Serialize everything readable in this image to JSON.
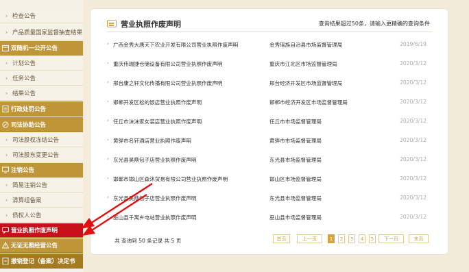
{
  "sidebar": {
    "items": [
      {
        "label": "检查公告",
        "kind": "sub"
      },
      {
        "label": "产品质量国家监督抽查结果",
        "kind": "sub"
      },
      {
        "label": "双随机一公开公告",
        "kind": "head",
        "icon": "calendar-icon"
      },
      {
        "label": "计划公告",
        "kind": "sub"
      },
      {
        "label": "任务公告",
        "kind": "sub"
      },
      {
        "label": "结果公告",
        "kind": "sub"
      },
      {
        "label": "行政处罚公告",
        "kind": "head",
        "icon": "document-icon"
      },
      {
        "label": "司法协助公告",
        "kind": "head",
        "icon": "gavel-icon"
      },
      {
        "label": "司法股权冻结公告",
        "kind": "sub"
      },
      {
        "label": "司法股东变更公告",
        "kind": "sub"
      },
      {
        "label": "注销公告",
        "kind": "head",
        "icon": "monitor-icon"
      },
      {
        "label": "简易注销公告",
        "kind": "sub"
      },
      {
        "label": "清算组备案",
        "kind": "sub"
      },
      {
        "label": "债权人公告",
        "kind": "sub"
      },
      {
        "label": "营业执照作废声明",
        "kind": "active",
        "icon": "chat-icon"
      },
      {
        "label": "无证无照经营公告",
        "kind": "head",
        "icon": "warning-icon"
      },
      {
        "label": "撤销登记（备案）决定书",
        "kind": "dark",
        "icon": "doc-icon"
      }
    ]
  },
  "panel": {
    "title": "营业执照作废声明",
    "note": "查询结果超过50条，请输入更精确的查询条件",
    "rows": [
      {
        "name": "广西金秀大唐天下农业开发有限公司营业执照作废声明",
        "org": "金秀瑶族自治县市场监督管理局",
        "date": "2019/6/19"
      },
      {
        "name": "重庆伟瑞捷仓储设备有限公司营业执照作废声明",
        "org": "重庆市江北区市场监督管理局",
        "date": "2020/3/12"
      },
      {
        "name": "邢台康之轩文化传播有限公司营业执照作废声明",
        "org": "邢台经济开发区市场监督管理局",
        "date": "2020/3/12"
      },
      {
        "name": "邯郸开发区松的饭店营业执照作废声明",
        "org": "邯郸市经济开发区市场监督管理局",
        "date": "2020/3/12"
      },
      {
        "name": "任丘市沫沫家女装店营业执照作废声明",
        "org": "任丘市市场监督管理局",
        "date": "2020/3/12"
      },
      {
        "name": "黄骅市名轩酒店营业执照作废声明",
        "org": "黄骅市市场监督管理局",
        "date": "2020/3/12"
      },
      {
        "name": "东光县昊鼎包子店营业执照作废声明",
        "org": "东光县市场监督管理局",
        "date": "2020/3/12"
      },
      {
        "name": "邯郸市邯山区森沐贸易有限公司营业执照作废声明",
        "org": "邯山区市场监督管理局",
        "date": "2020/3/12"
      },
      {
        "name": "东光县昊鼎包子店营业执照作废声明",
        "org": "东光县市场监督管理局",
        "date": "2020/3/12"
      },
      {
        "name": "巫山县千寓乡电站营业执照作废声明",
        "org": "巫山县市场监督管理局",
        "date": "2020/3/12"
      }
    ],
    "total_text": "共 查询到 50 条记录 共 5 页",
    "pagination": {
      "first": "首页",
      "prev": "上一页",
      "pages": [
        "1",
        "2",
        "3",
        "4",
        "5"
      ],
      "current": "1",
      "next": "下一页",
      "last": "末页"
    }
  },
  "colors": {
    "accent": "#bf9638",
    "active": "#c8101a",
    "annotation_arrow": "#e01010",
    "link_dot": "#4a8fcf"
  }
}
